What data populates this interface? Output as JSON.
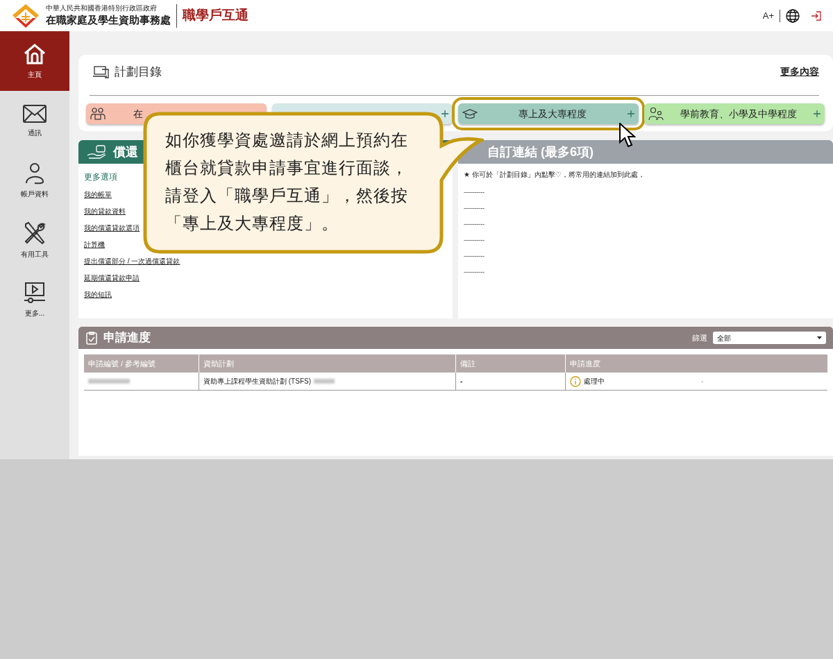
{
  "header": {
    "org_small": "中華人民共和國香港特別行政區政府",
    "org_name": "在職家庭及學生資助事務處",
    "brand": "職學戶互通",
    "font_size": "A+"
  },
  "sidebar": {
    "items": [
      {
        "label": "主頁",
        "kind": "home",
        "selected": true
      },
      {
        "label": "通訊",
        "kind": "mail",
        "selected": false
      },
      {
        "label": "帳戶資料",
        "kind": "person",
        "selected": false
      },
      {
        "label": "有用工具",
        "kind": "tools",
        "selected": false
      },
      {
        "label": "更多...",
        "kind": "video",
        "selected": false
      }
    ]
  },
  "catalog": {
    "title": "計劃目錄",
    "more_link": "更多內容",
    "categories": [
      {
        "label": "在",
        "color": "#f6bfae",
        "kind": "family",
        "highlighted": false
      },
      {
        "color": "#d5e8e8",
        "kind": "plain",
        "highlighted": false
      },
      {
        "label": "專上及大專程度",
        "color": "#9fcbbf",
        "kind": "cap",
        "highlighted": true
      },
      {
        "label": "學前教育、小學及中學程度",
        "color": "#b5e6a6",
        "kind": "kids",
        "highlighted": false
      }
    ]
  },
  "repay": {
    "title": "償還",
    "section": "更多選項",
    "links": [
      "我的帳單",
      "我的貸款資料",
      "我的償還貸款選項",
      "計算機",
      "提出償還部分 / 一次過償還貸款",
      "延期償還貸款申請",
      "我的短訊"
    ]
  },
  "custom_links": {
    "title": "自訂連結 (最多6項)",
    "note": "★ 你可於「計劃目錄」內點擊♡，將常用的連結加到此處，",
    "slots": [
      "----------",
      "----------",
      "----------",
      "----------",
      "----------",
      "----------"
    ]
  },
  "progress": {
    "title": "申請進度",
    "filter_label": "篩選",
    "filter_value": "全部",
    "columns": [
      "申請編號 / 參考編號",
      "資助計劃",
      "備註",
      "申請進度"
    ],
    "rows": [
      {
        "scheme": "資助專上課程學生資助計劃 (TSFS)",
        "remark": "-",
        "status": "處理中",
        "extra": "-"
      }
    ]
  },
  "callout": {
    "lines": [
      "如你獲學資處邀請於網上預約在",
      "櫃台就貸款申請事宜進行面談，",
      "請登入「職學戶互通」，然後按",
      "「專上及大專程度」。"
    ]
  }
}
